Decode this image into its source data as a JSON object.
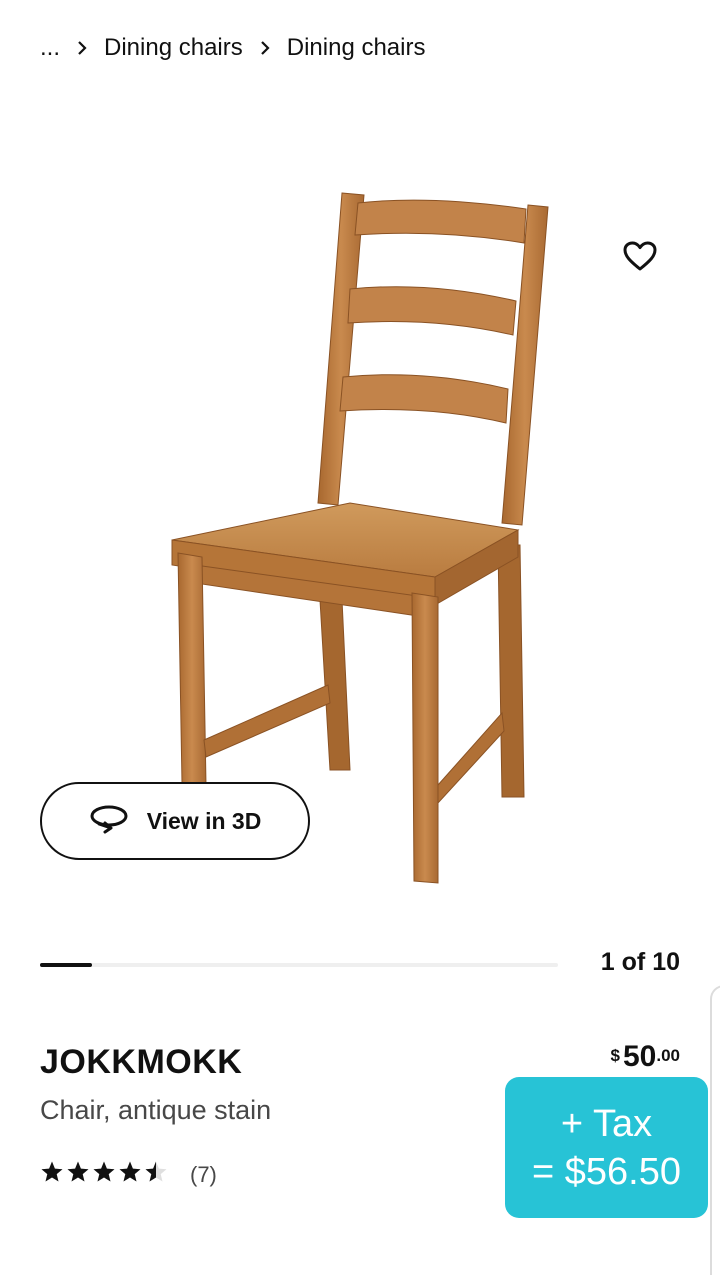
{
  "breadcrumb": {
    "ellipsis": "...",
    "items": [
      "Dining chairs",
      "Dining chairs"
    ]
  },
  "image": {
    "subject": "wooden ladder-back dining chair, antique stain",
    "counter": "1 of 10",
    "progress": 0.1
  },
  "actions": {
    "view_3d_label": "View in 3D",
    "favorite_icon": "heart-outline-icon",
    "view_3d_icon": "rotate-3d-icon"
  },
  "product": {
    "name": "JOKKMOKK",
    "description": "Chair, antique stain",
    "rating": 4.5,
    "rating_max": 5,
    "review_count": "(7)"
  },
  "price": {
    "currency": "$",
    "integer": "50",
    "decimal": ".00"
  },
  "tax_overlay": {
    "line1": "+ Tax",
    "line2": "= $56.50",
    "color": "#27c3d6"
  }
}
